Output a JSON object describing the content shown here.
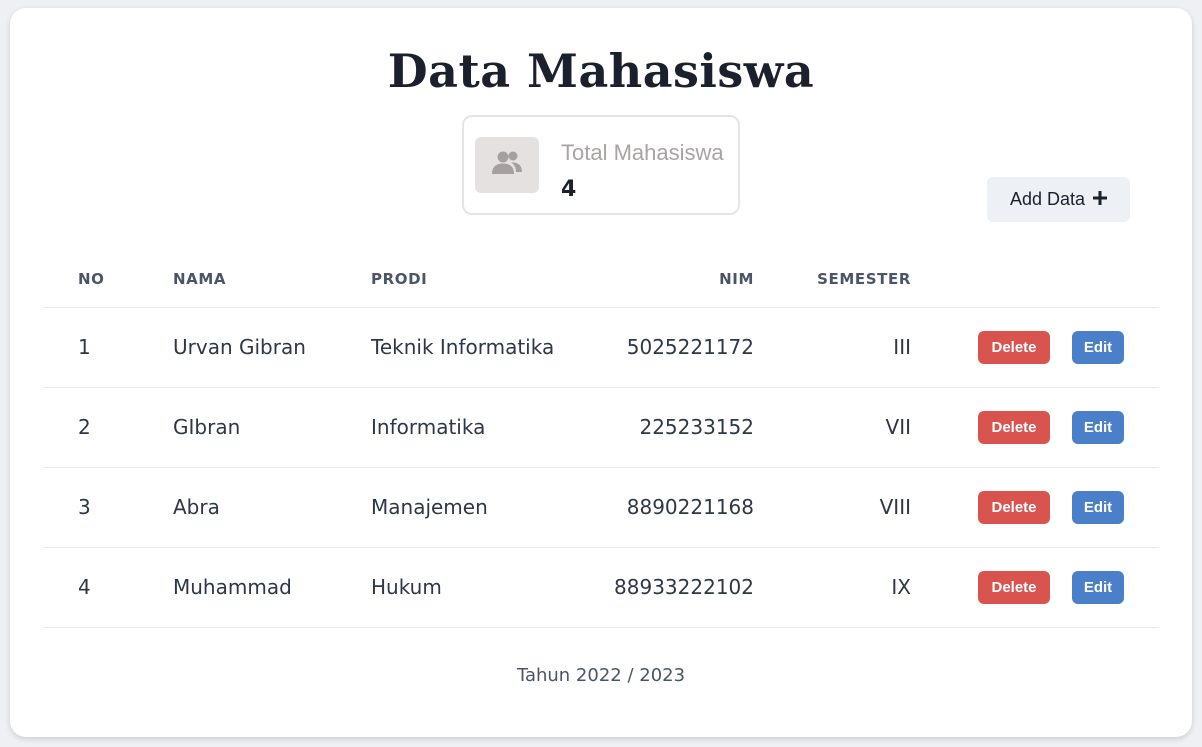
{
  "page": {
    "title": "Data Mahasiswa",
    "footer": "Tahun 2022 / 2023"
  },
  "stat": {
    "label": "Total Mahasiswa",
    "value": "4",
    "icon": "users-icon"
  },
  "toolbar": {
    "add_label": "Add Data",
    "add_icon": "plus-icon"
  },
  "table": {
    "headers": {
      "no": "NO",
      "nama": "NAMA",
      "prodi": "PRODI",
      "nim": "NIM",
      "semester": "SEMESTER"
    },
    "rows": [
      {
        "no": "1",
        "nama": "Urvan Gibran",
        "prodi": "Teknik Informatika",
        "nim": "5025221172",
        "semester": "III",
        "delete_label": "Delete",
        "edit_label": "Edit"
      },
      {
        "no": "2",
        "nama": "GIbran",
        "prodi": "Informatika",
        "nim": "225233152",
        "semester": "VII",
        "delete_label": "Delete",
        "edit_label": "Edit"
      },
      {
        "no": "3",
        "nama": "Abra",
        "prodi": "Manajemen",
        "nim": "8890221168",
        "semester": "VIII",
        "delete_label": "Delete",
        "edit_label": "Edit"
      },
      {
        "no": "4",
        "nama": "Muhammad",
        "prodi": "Hukum",
        "nim": "88933222102",
        "semester": "IX",
        "delete_label": "Delete",
        "edit_label": "Edit"
      }
    ]
  },
  "colors": {
    "delete": "#d9534f",
    "edit": "#4a7fc9"
  }
}
